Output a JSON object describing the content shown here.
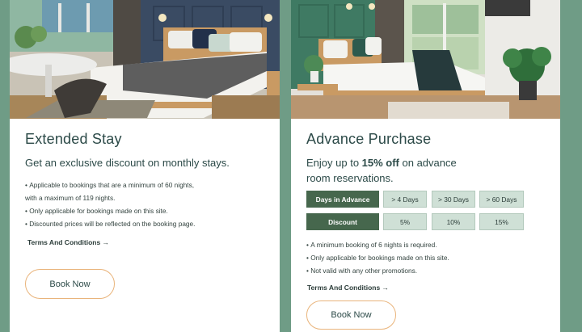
{
  "cards": {
    "extended": {
      "title": "Extended Stay",
      "subtitle": "Get an exclusive discount on monthly stays.",
      "bullets": [
        "Applicable to bookings that are a minimum of 60 nights,",
        "with a maximum of 119 nights.",
        "Only applicable for bookings made on this site.",
        "Discounted prices will be reflected on the booking page."
      ],
      "terms_label": "Terms And Conditions →",
      "book_label": "Book Now"
    },
    "advance": {
      "title": "Advance Purchase",
      "subtitle_before": "Enjoy up to ",
      "subtitle_bold": "15% off",
      "subtitle_after": " on advance",
      "subtitle_line2": "room reservations.",
      "table": {
        "row1_header": "Days in Advance",
        "row1": [
          "> 4 Days",
          "> 30 Days",
          "> 60 Days"
        ],
        "row2_header": "Discount",
        "row2": [
          "5%",
          "10%",
          "15%"
        ]
      },
      "bullets": [
        "A minimum booking of 6 nights is required.",
        "Only applicable for bookings made on this site.",
        "Not valid with any other promotions."
      ],
      "terms_label": "Terms And Conditions →",
      "book_label": "Book Now"
    }
  },
  "colors": {
    "page_background": "#6f9c86",
    "heading_text": "#2c4a48",
    "table_header_bg": "#46674d",
    "table_cell_bg": "#cfe0d6",
    "button_border": "#e9b47b"
  }
}
